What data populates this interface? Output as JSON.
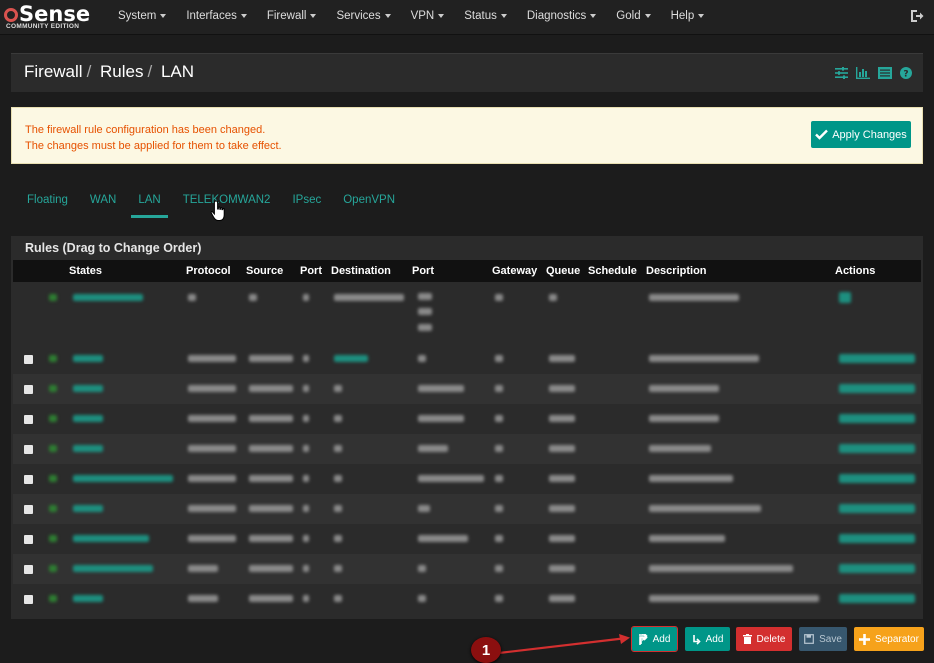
{
  "brand": {
    "logo": "Sense",
    "edition": "COMMUNITY EDITION"
  },
  "nav": {
    "items": [
      "System",
      "Interfaces",
      "Firewall",
      "Services",
      "VPN",
      "Status",
      "Diagnostics",
      "Gold",
      "Help"
    ]
  },
  "header": {
    "crumb1": "Firewall",
    "crumb2": "Rules",
    "crumb3": "LAN",
    "icons": [
      "sliders-icon",
      "bar-chart-icon",
      "list-icon",
      "help-icon"
    ]
  },
  "alert": {
    "line1": "The firewall rule configuration has been changed.",
    "line2": "The changes must be applied for them to take effect.",
    "apply_label": "Apply Changes"
  },
  "tabs": [
    "Floating",
    "WAN",
    "LAN",
    "TELEKOMWAN2",
    "IPsec",
    "OpenVPN"
  ],
  "active_tab": "LAN",
  "panel": {
    "title": "Rules (Drag to Change Order)",
    "columns": [
      "States",
      "Protocol",
      "Source",
      "Port",
      "Destination",
      "Port",
      "Gateway",
      "Queue",
      "Schedule",
      "Description",
      "Actions"
    ]
  },
  "buttons": {
    "add_top": "Add",
    "add_bottom": "Add",
    "delete": "Delete",
    "save": "Save",
    "separator": "Separator"
  },
  "annotation": {
    "badge": "1"
  },
  "colors": {
    "accent": "#009688",
    "danger": "#d32f2f",
    "warning": "#f6a21b",
    "alert_text": "#e65100"
  }
}
